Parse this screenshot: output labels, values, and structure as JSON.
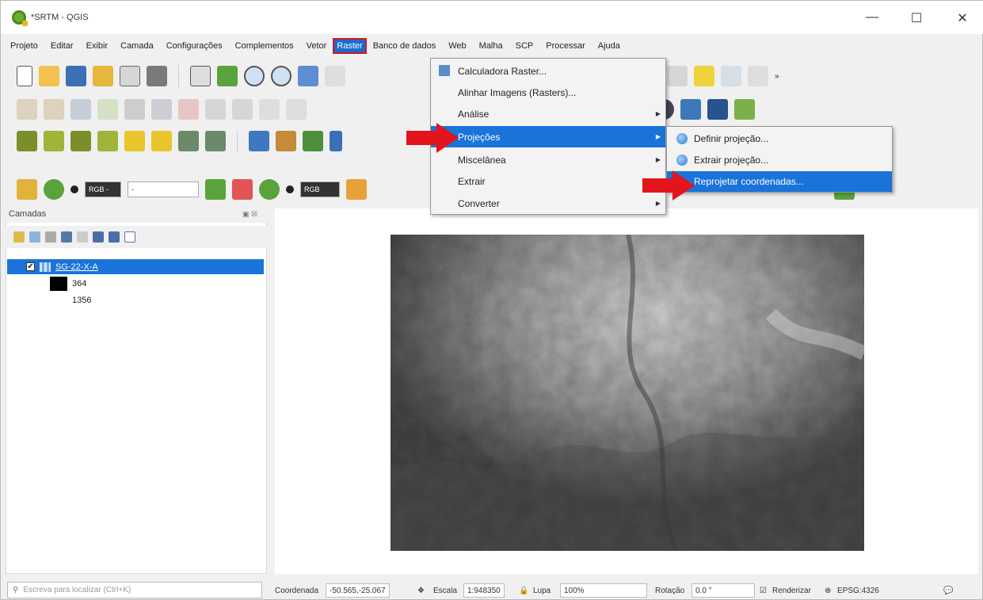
{
  "window": {
    "title": "*SRTM - QGIS",
    "minimize": "—",
    "maximize": "☐",
    "close": "✕"
  },
  "menubar": [
    "Projeto",
    "Editar",
    "Exibir",
    "Camada",
    "Configurações",
    "Complementos",
    "Vetor",
    "Raster",
    "Banco de dados",
    "Web",
    "Malha",
    "SCP",
    "Processar",
    "Ajuda"
  ],
  "toolbar": {
    "rgb_combo": "RGB -",
    "dash_combo": "-",
    "rgb_combo2": "RGB"
  },
  "raster_menu": {
    "items": [
      {
        "label": "Calculadora Raster...",
        "submenu": false
      },
      {
        "label": "Alinhar Imagens (Rasters)...",
        "submenu": false
      },
      {
        "label": "Análise",
        "submenu": true
      },
      {
        "label": "Projeções",
        "submenu": true
      },
      {
        "label": "Miscelânea",
        "submenu": true
      },
      {
        "label": "Extrair",
        "submenu": true
      },
      {
        "label": "Converter",
        "submenu": true
      }
    ],
    "highlighted": "Projeções"
  },
  "projections_submenu": {
    "items": [
      "Definir projeção...",
      "Extrair projeção...",
      "Reprojetar coordenadas..."
    ],
    "highlighted": "Reprojetar coordenadas..."
  },
  "layers_panel": {
    "title": "Camadas",
    "layer_name": "SG-22-X-A",
    "legend_min": "364",
    "legend_max": "1356",
    "checked": true
  },
  "statusbar": {
    "locator_placeholder": "Escreva para localizar (Ctrl+K)",
    "coord_label": "Coordenada",
    "coord_value": "-50.565,-25.067",
    "scale_label": "Escala",
    "scale_value": "1:948350",
    "magnifier_label": "Lupa",
    "magnifier_value": "100%",
    "rotation_label": "Rotação",
    "rotation_value": "0.0 °",
    "render_label": "Renderizar",
    "crs": "EPSG:4326"
  },
  "colors": {
    "highlight": "#1a73d9",
    "red_arrow": "#e3141c"
  }
}
